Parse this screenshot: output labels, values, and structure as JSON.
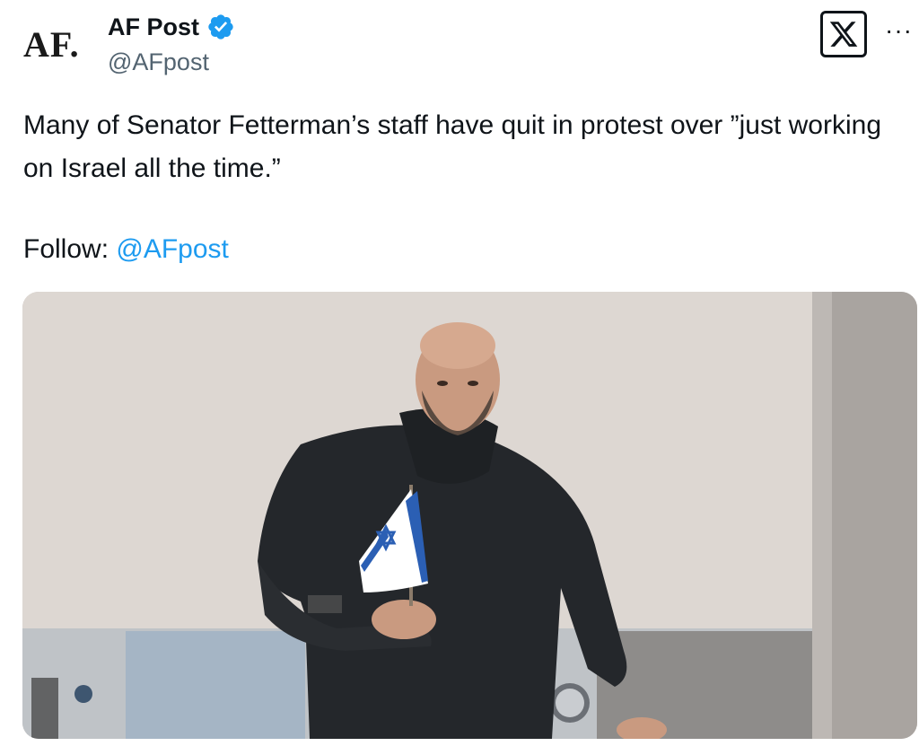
{
  "account": {
    "avatar_text": "AF.",
    "display_name": "AF Post",
    "handle": "@AFpost",
    "verified": true
  },
  "tweet": {
    "text": "Many of Senator Fetterman’s staff have quit in protest over ”just working on Israel all the time.”",
    "follow_label": "Follow: ",
    "follow_mention": "@AFpost"
  },
  "media": {
    "description_icon": "photo"
  },
  "colors": {
    "accent": "#1d9bf0",
    "text": "#0f1419",
    "secondary": "#536471"
  }
}
